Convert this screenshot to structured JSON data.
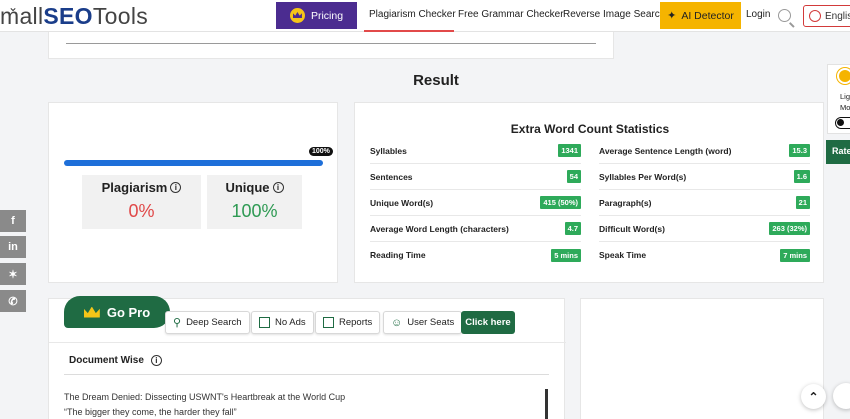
{
  "nav": {
    "logo_part1": "mall",
    "logo_part2": "SEO",
    "logo_part3": "Tools",
    "pricing": "Pricing",
    "plagiarism_checker": "Plagiarism Checker",
    "grammar_checker": "Free Grammar Checker",
    "reverse_image": "Reverse Image Search",
    "ai_detector": "AI Detector",
    "login": "Login",
    "language": "Englis"
  },
  "result": {
    "title": "Result",
    "progress_label": "100%",
    "progress_value": 1.0,
    "plagiarism_label": "Plagiarism",
    "plagiarism_value": "0%",
    "unique_label": "Unique",
    "unique_value": "100%"
  },
  "stats": {
    "title": "Extra Word Count Statistics",
    "left": [
      {
        "label": "Syllables",
        "value": "1341"
      },
      {
        "label": "Sentences",
        "value": "54"
      },
      {
        "label": "Unique Word(s)",
        "value": "415 (50%)"
      },
      {
        "label": "Average Word Length (characters)",
        "value": "4.7"
      },
      {
        "label": "Reading Time",
        "value": "5 mins"
      }
    ],
    "right": [
      {
        "label": "Average Sentence Length (word)",
        "value": "15.3"
      },
      {
        "label": "Syllables Per Word(s)",
        "value": "1.6"
      },
      {
        "label": "Paragraph(s)",
        "value": "21"
      },
      {
        "label": "Difficult Word(s)",
        "value": "263 (32%)"
      },
      {
        "label": "Speak Time",
        "value": "7 mins"
      }
    ]
  },
  "social": {
    "facebook": "f",
    "linkedin": "in",
    "twitter": "t",
    "whatsapp": "w"
  },
  "theme": {
    "light": "Lig",
    "mode": "Mo"
  },
  "rate_tab": "Rate",
  "pro": {
    "go_pro": "Go Pro",
    "deep_search": "Deep Search",
    "no_ads": "No Ads",
    "reports": "Reports",
    "user_seats": "User Seats",
    "click_here": "Click here",
    "doc_wise": "Document Wise",
    "doc_line1": "The Dream Denied: Dissecting USWNT's Heartbreak at the World Cup",
    "doc_line2": "“The bigger they come, the harder they fall”"
  },
  "colors": {
    "brand_purple": "#4b2c90",
    "brand_green": "#1f6b43",
    "accent_yellow": "#f5b400",
    "progress_blue": "#1e6fd9",
    "plag_red": "#e04848",
    "unique_green": "#2e9a53"
  }
}
